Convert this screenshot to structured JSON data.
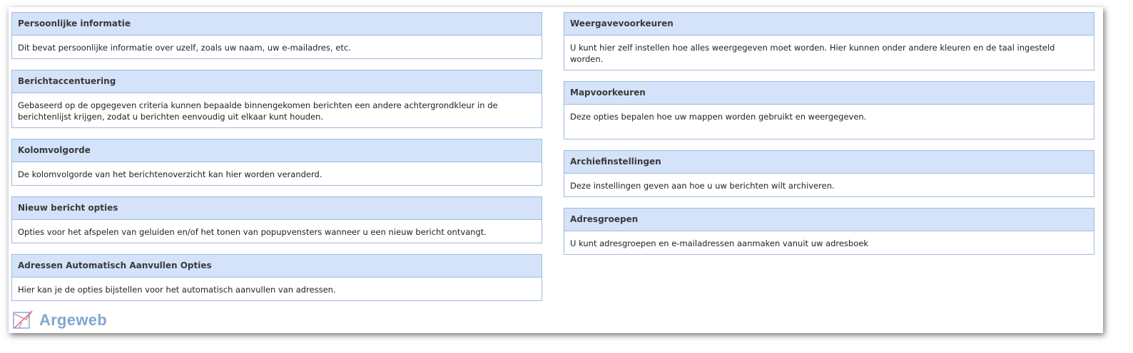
{
  "left_column": [
    {
      "title": "Persoonlijke informatie",
      "description": "Dit bevat persoonlijke informatie over uzelf, zoals uw naam, uw e-mailadres, etc."
    },
    {
      "title": "Berichtaccentuering",
      "description": "Gebaseerd op de opgegeven criteria kunnen bepaalde binnengekomen berichten een andere achtergrondkleur in de berichtenlijst krijgen, zodat u berichten eenvoudig uit elkaar kunt houden."
    },
    {
      "title": "Kolomvolgorde",
      "description": "De kolomvolgorde van het berichtenoverzicht kan hier worden veranderd."
    },
    {
      "title": "Nieuw bericht opties",
      "description": "Opties voor het afspelen van geluiden en/of het tonen van popupvensters wanneer u een nieuw bericht ontvangt."
    },
    {
      "title": "Adressen Automatisch Aanvullen Opties",
      "description": "Hier kan je de opties bijstellen voor het automatisch aanvullen van adressen."
    }
  ],
  "right_column": [
    {
      "title": "Weergavevoorkeuren",
      "description": "U kunt hier zelf instellen hoe alles weergegeven moet worden. Hier kunnen onder andere kleuren en de taal ingesteld worden."
    },
    {
      "title": "Mapvoorkeuren",
      "description": "Deze opties bepalen hoe uw mappen worden gebruikt en weergegeven."
    },
    {
      "title": "Archiefinstellingen",
      "description": "Deze instellingen geven aan hoe u uw berichten wilt archiveren."
    },
    {
      "title": "Adresgroepen",
      "description": "U kunt adresgroepen en e-mailadressen aanmaken vanuit uw adresboek"
    }
  ],
  "logo": {
    "text": "Argeweb",
    "icon": "argeweb-logo-icon"
  },
  "colors": {
    "header_bg": "#d4e3fa",
    "border": "#9fbadb",
    "logo_text": "#7fa8cf",
    "logo_mark": "#e07a9a"
  }
}
